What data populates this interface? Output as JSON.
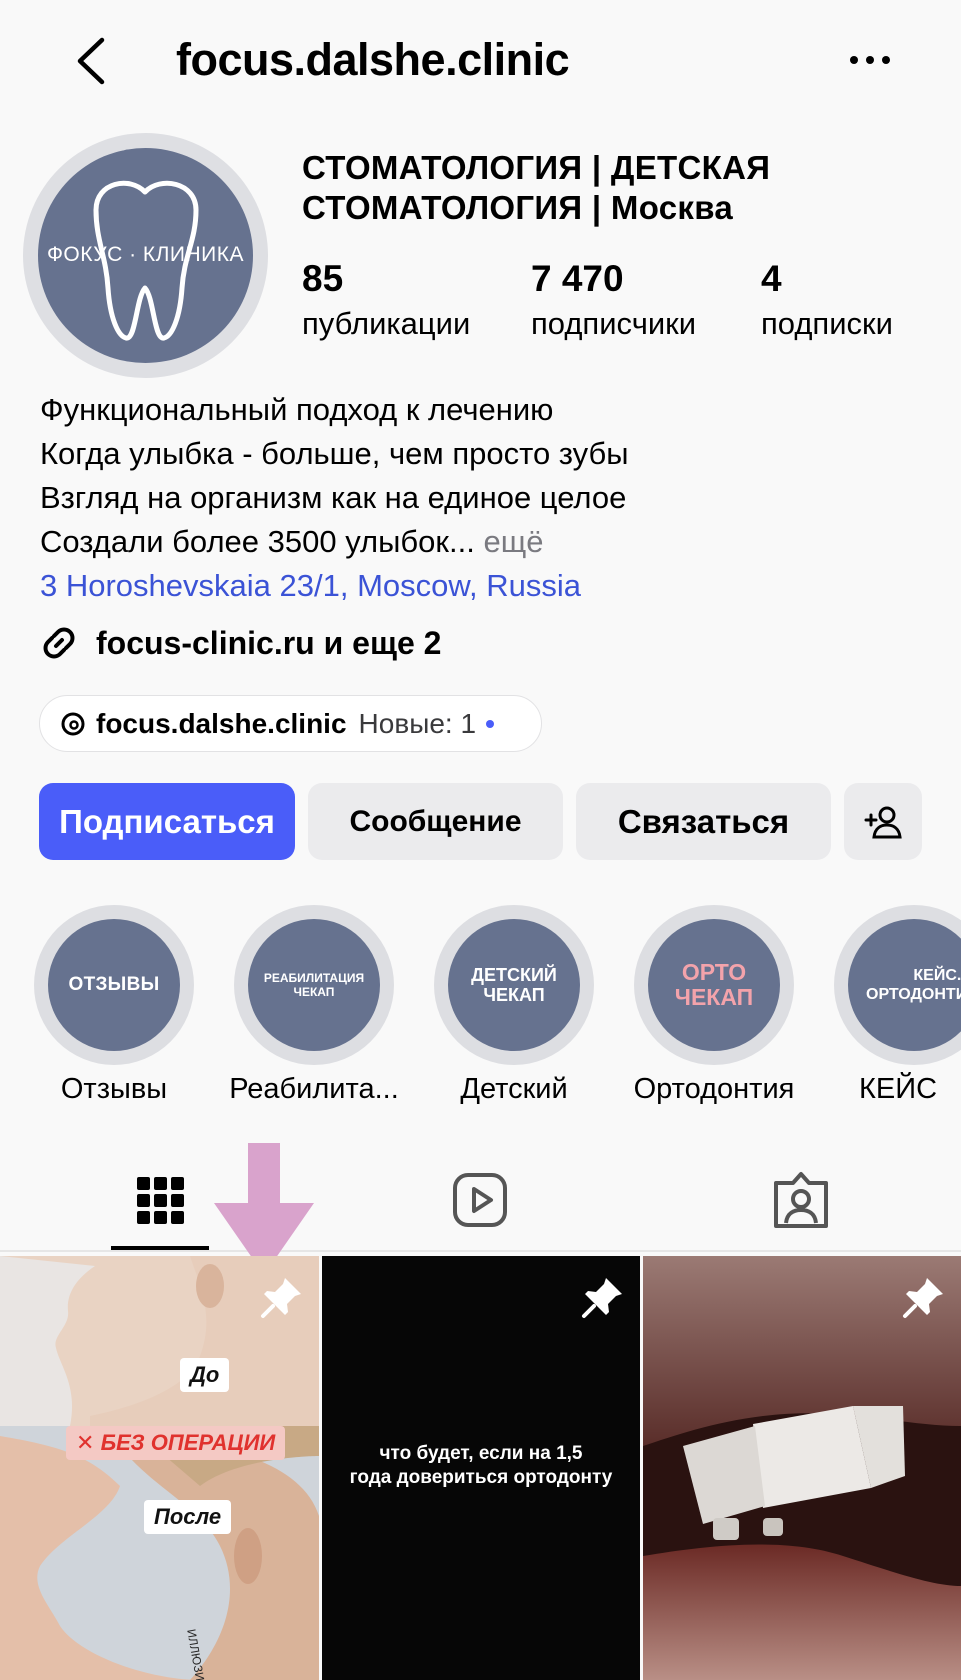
{
  "header": {
    "handle": "focus.dalshe.clinic"
  },
  "avatar": {
    "text": "ФОКУС · КЛИНИКА"
  },
  "profile": {
    "category_line1": "СТОМАТОЛОГИЯ | ДЕТСКАЯ",
    "category_line2": "СТОМАТОЛОГИЯ | Москва",
    "stats": [
      {
        "value": "85",
        "label": "публикации"
      },
      {
        "value": "7 470",
        "label": "подписчики"
      },
      {
        "value": "4",
        "label": "подписки"
      }
    ],
    "bio_lines": [
      "Функциональный подход к лечению",
      "Когда улыбка - больше, чем просто зубы",
      "Взгляд на организм как на единое целое",
      "Создали более 3500 улыбок..."
    ],
    "more_label": "ещё",
    "address": "3 Horoshevskaia 23/1, Moscow, Russia",
    "link": "focus-clinic.ru и еще 2",
    "threads": {
      "name": "focus.dalshe.clinic",
      "new_label": "Новые: 1"
    }
  },
  "actions": {
    "follow": "Подписаться",
    "message": "Сообщение",
    "contact": "Связаться"
  },
  "highlights": [
    {
      "cover": "ОТЗЫВЫ",
      "label": "Отзывы"
    },
    {
      "cover_l1": "РЕАБИЛИТАЦИЯ",
      "cover_l2": "ЧЕКАП",
      "label": "Реабилита..."
    },
    {
      "cover_l1": "ДЕТСКИЙ",
      "cover_l2": "ЧЕКАП",
      "label": "Детский"
    },
    {
      "cover_l1": "ОРТО",
      "cover_l2": "ЧЕКАП",
      "label": "Ортодонтия"
    },
    {
      "cover_l1": "КЕЙС.",
      "cover_l2": "ОРТОДОНТИЯ",
      "label": "КЕЙС"
    }
  ],
  "tabs": [
    "grid-icon",
    "reels-icon",
    "tagged-icon"
  ],
  "posts": [
    {
      "tag_before": "До",
      "tag_red": "БЕЗ ОПЕРАЦИИ",
      "tag_after": "После",
      "earring_text": "ИЛЛЮЗИЯ",
      "pinned": true
    },
    {
      "caption_l1": "что будет, если на 1,5",
      "caption_l2": "года довериться ортодонту",
      "pinned": true
    },
    {
      "pinned": true
    }
  ],
  "colors": {
    "accent": "#4a5df9",
    "link": "#3b53d6",
    "highlight_disc": "#66728f",
    "annotation_arrow": "#d9a3cc"
  }
}
